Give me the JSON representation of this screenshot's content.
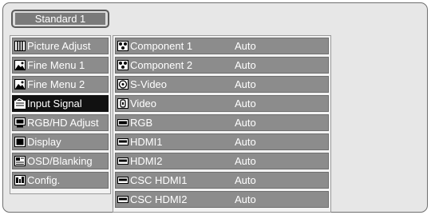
{
  "header": {
    "tab_label": "Standard 1"
  },
  "sidebar": {
    "items": [
      {
        "label": "Picture Adjust",
        "icon": "grid-icon"
      },
      {
        "label": "Fine Menu 1",
        "icon": "landscape-icon"
      },
      {
        "label": "Fine Menu 2",
        "icon": "landscape-icon"
      },
      {
        "label": "Input Signal",
        "icon": "input-signal-icon",
        "active": true
      },
      {
        "label": "RGB/HD Adjust",
        "icon": "monitor-icon"
      },
      {
        "label": "Display",
        "icon": "display-icon"
      },
      {
        "label": "OSD/Blanking",
        "icon": "osd-icon"
      },
      {
        "label": "Config.",
        "icon": "config-icon"
      }
    ]
  },
  "input_list": {
    "rows": [
      {
        "label": "Component 1",
        "value": "Auto",
        "icon": "component-connector-icon"
      },
      {
        "label": "Component 2",
        "value": "Auto",
        "icon": "component-connector-icon"
      },
      {
        "label": "S-Video",
        "value": "Auto",
        "icon": "svideo-connector-icon"
      },
      {
        "label": "Video",
        "value": "Auto",
        "icon": "video-connector-icon"
      },
      {
        "label": "RGB",
        "value": "Auto",
        "icon": "rgb-connector-icon"
      },
      {
        "label": "HDMI1",
        "value": "Auto",
        "icon": "hdmi-connector-icon"
      },
      {
        "label": "HDMI2",
        "value": "Auto",
        "icon": "hdmi-connector-icon"
      },
      {
        "label": "CSC HDMI1",
        "value": "Auto",
        "icon": "hdmi-connector-icon"
      },
      {
        "label": "CSC HDMI2",
        "value": "Auto",
        "icon": "hdmi-connector-icon"
      }
    ]
  },
  "colors": {
    "panel_bg": "#e7e7e7",
    "item_bg": "#8c8c8c",
    "active_bg": "#111111",
    "text": "#ffffff"
  }
}
